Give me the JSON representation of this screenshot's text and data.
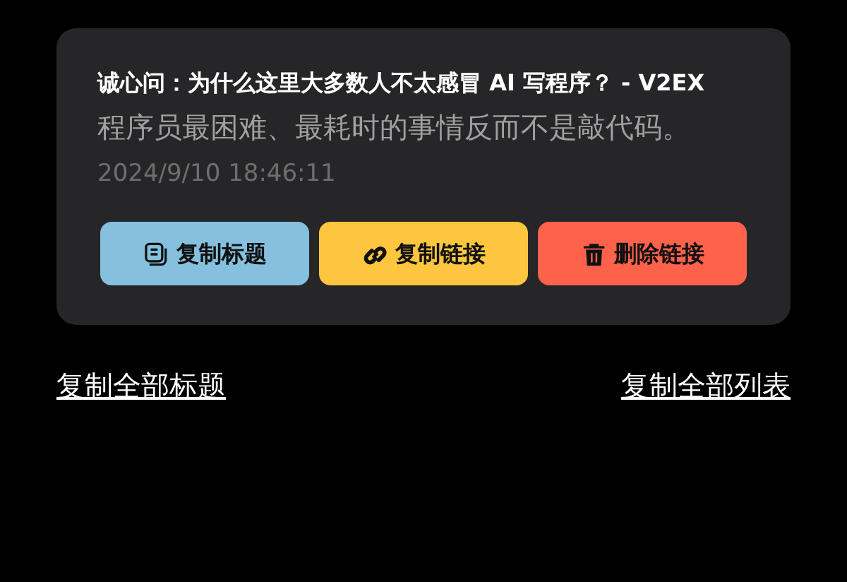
{
  "card": {
    "title": "诚心问：为什么这里大多数人不太感冒 AI 写程序？ - V2EX",
    "description": "程序员最困难、最耗时的事情反而不是敲代码。",
    "timestamp": "2024/9/10 18:46:11",
    "buttons": [
      {
        "kind": "copy_title",
        "label": "复制标题"
      },
      {
        "kind": "copy_link",
        "label": "复制链接"
      },
      {
        "kind": "delete",
        "label": "删除链接"
      }
    ]
  },
  "links": [
    "复制全部标题",
    "复制全部列表"
  ]
}
